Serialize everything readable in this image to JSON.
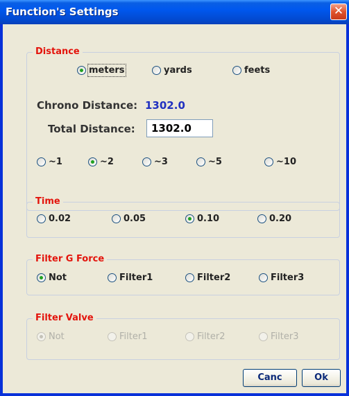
{
  "window": {
    "title": "Function's Settings",
    "close_glyph": "✕"
  },
  "distance": {
    "legend": "Distance",
    "units": [
      {
        "label": "meters",
        "checked": true,
        "focused": true
      },
      {
        "label": "yards",
        "checked": false
      },
      {
        "label": "feets",
        "checked": false
      }
    ],
    "chrono_label": "Chrono Distance:",
    "chrono_value": "1302.0",
    "total_label": "Total Distance:",
    "total_value": "1302.0",
    "multipliers": [
      {
        "label": "~1",
        "checked": false
      },
      {
        "label": "~2",
        "checked": true
      },
      {
        "label": "~3",
        "checked": false
      },
      {
        "label": "~5",
        "checked": false
      },
      {
        "label": "~10",
        "checked": false
      }
    ]
  },
  "time": {
    "legend": "Time",
    "options": [
      {
        "label": "0.02",
        "checked": false
      },
      {
        "label": "0.05",
        "checked": false
      },
      {
        "label": "0.10",
        "checked": true
      },
      {
        "label": "0.20",
        "checked": false
      }
    ]
  },
  "filter_g": {
    "legend": "Filter G Force",
    "options": [
      {
        "label": "Not",
        "checked": true
      },
      {
        "label": "Filter1",
        "checked": false
      },
      {
        "label": "Filter2",
        "checked": false
      },
      {
        "label": "Filter3",
        "checked": false
      }
    ]
  },
  "filter_valve": {
    "legend": "Filter Valve",
    "disabled": true,
    "options": [
      {
        "label": "Not",
        "checked": true
      },
      {
        "label": "Filter1",
        "checked": false
      },
      {
        "label": "Filter2",
        "checked": false
      },
      {
        "label": "Filter3",
        "checked": false
      }
    ]
  },
  "buttons": {
    "cancel_label": "Canc",
    "ok_label": "Ok"
  }
}
